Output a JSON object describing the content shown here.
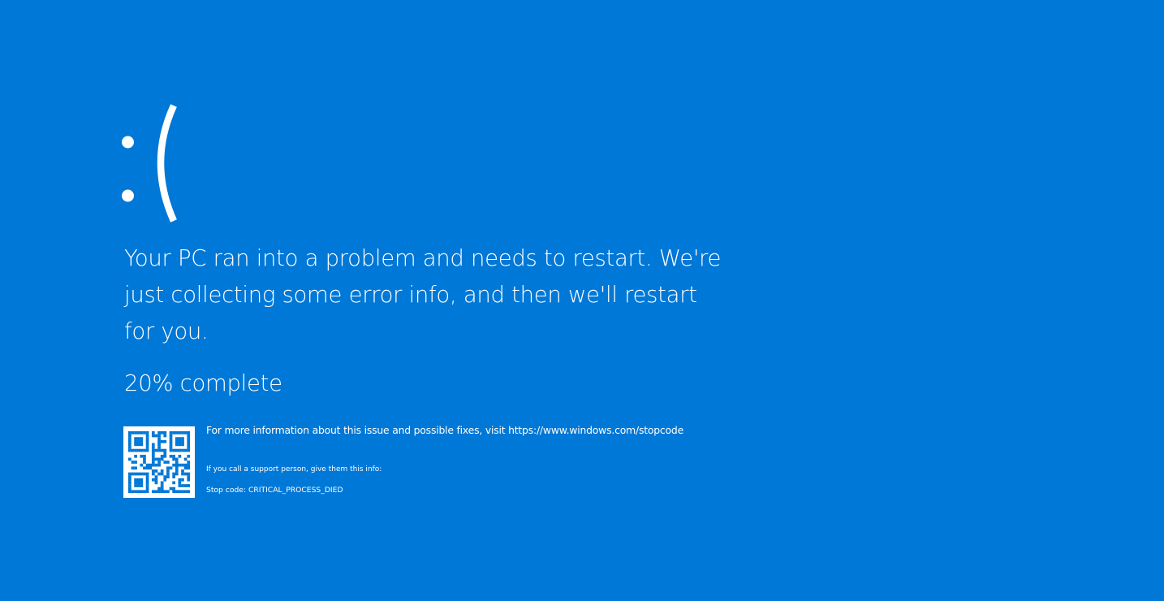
{
  "screen": {
    "background_color": "#0078d7",
    "text_color": "#ffffff",
    "icon": "sad-face-icon",
    "sad_face": ":(",
    "message": "Your PC ran into a problem and needs to restart. We're just collecting some error info, and then we'll restart for you.",
    "progress_text": "20% complete",
    "progress_percent": 20,
    "qr_icon": "qr-code-icon",
    "more_info": "For more information about this issue and possible fixes, visit https://www.windows.com/stopcode",
    "support_text": "If you call a support person, give them this info:",
    "stop_code": "Stop code: CRITICAL_PROCESS_DIED"
  }
}
